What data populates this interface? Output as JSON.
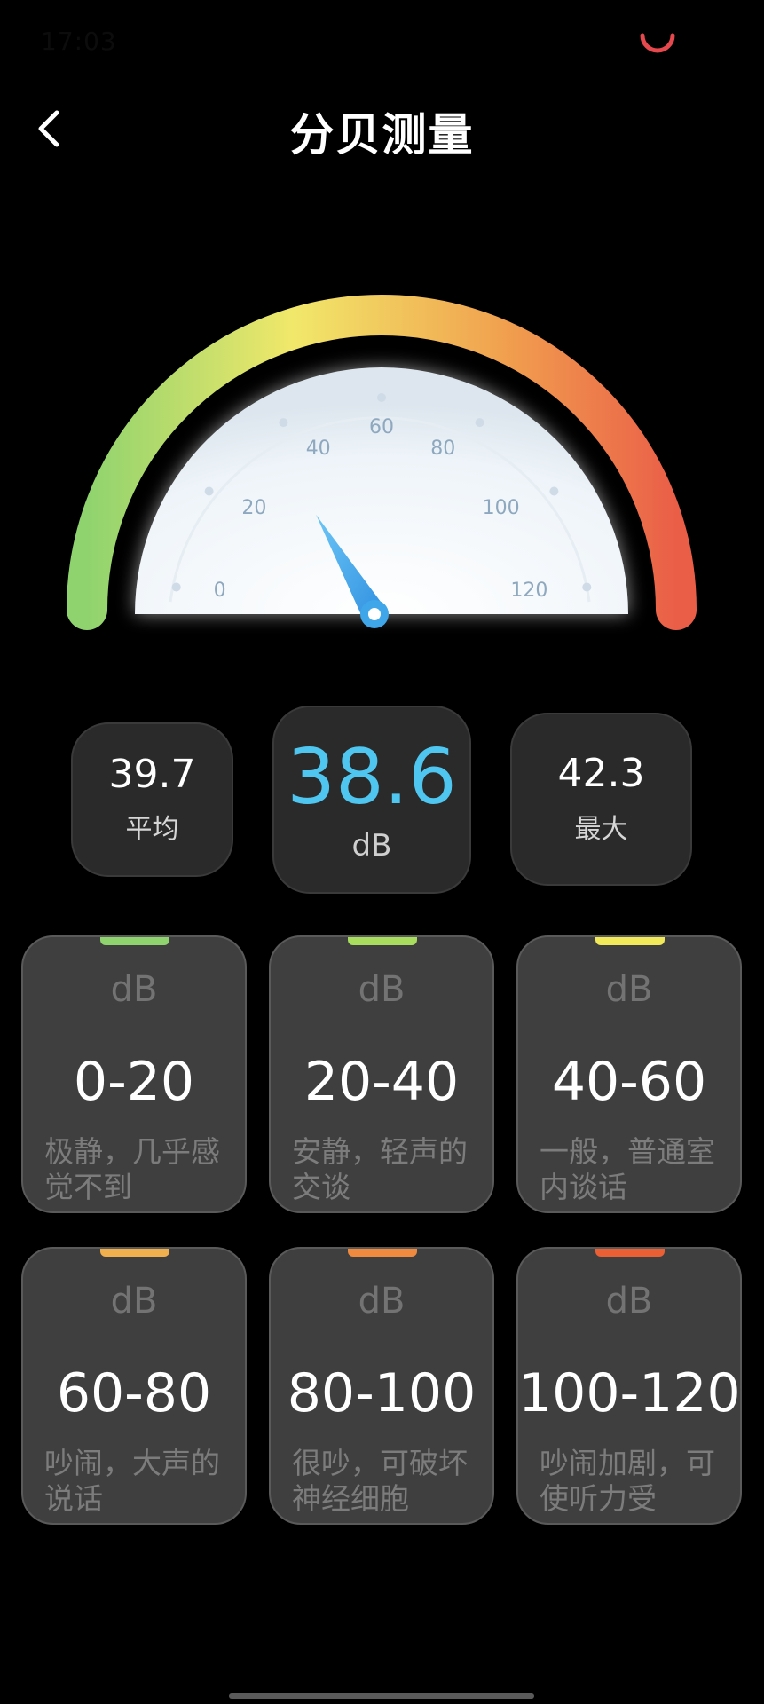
{
  "status_bar": {
    "time": "17:03"
  },
  "header": {
    "title": "分贝测量",
    "back_icon": "chevron-left-icon"
  },
  "gauge": {
    "min": 0,
    "max": 120,
    "ticks": [
      "0",
      "20",
      "40",
      "60",
      "80",
      "100",
      "120"
    ],
    "needle_value": 38.6,
    "colors": {
      "low": "#8fd36e",
      "mid": "#f1e86a",
      "high": "#ea5e48",
      "needle": "#3fa6ea"
    }
  },
  "stats": {
    "average": {
      "value": "39.7",
      "label": "平均"
    },
    "current": {
      "value": "38.6",
      "unit": "dB",
      "color": "#4fc6f0"
    },
    "maximum": {
      "value": "42.3",
      "label": "最大"
    }
  },
  "ranges": [
    {
      "unit": "dB",
      "value": "0-20",
      "desc": "极静，几乎感觉不到",
      "accent": "#8fd36e"
    },
    {
      "unit": "dB",
      "value": "20-40",
      "desc": "安静，轻声的交谈",
      "accent": "#a8dd5e"
    },
    {
      "unit": "dB",
      "value": "40-60",
      "desc": "一般，普通室内谈话",
      "accent": "#f1e85a"
    },
    {
      "unit": "dB",
      "value": "60-80",
      "desc": "吵闹，大声的说话",
      "accent": "#f0b04e"
    },
    {
      "unit": "dB",
      "value": "80-100",
      "desc": "很吵，可破坏神经细胞",
      "accent": "#ef8a3e"
    },
    {
      "unit": "dB",
      "value": "100-120",
      "desc": "吵闹加剧，可使听力受",
      "accent": "#ea6034"
    }
  ]
}
